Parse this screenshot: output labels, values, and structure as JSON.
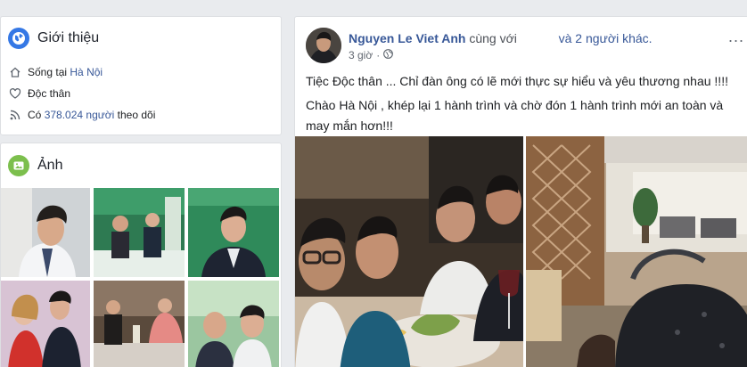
{
  "intro": {
    "title": "Giới thiệu",
    "lives_prefix": "Sống tại",
    "lives_city": "Hà Nội",
    "relationship": "Độc thân",
    "followers_prefix": "Có",
    "followers_count": "378.024 người",
    "followers_suffix": "theo dõi",
    "icons": [
      "globe-icon",
      "home-icon",
      "heart-icon",
      "rss-icon"
    ]
  },
  "photos": {
    "title": "Ảnh",
    "icon": "photo-icon",
    "items": [
      "photo-1",
      "photo-2",
      "photo-3",
      "photo-4",
      "photo-5",
      "photo-6"
    ]
  },
  "post": {
    "author": "Nguyen Le Viet Anh",
    "with_text": "cùng với",
    "others": "và 2 người khác.",
    "time": "3 giờ",
    "privacy_icon": "globe-icon",
    "menu": "...",
    "line1": "Tiệc Độc thân ... Chỉ đàn ông có lẽ mới thực sự hiểu và yêu thương nhau !!!!",
    "line2": "Chào Hà Nội , khép lại 1 hành trình và chờ đón 1 hành trình mới an toàn và may mắn hơn!!!"
  },
  "colors": {
    "link": "#385898",
    "background": "#e9ebee",
    "globe_blue": "#3578e5",
    "photo_green": "#7cbf4d"
  }
}
